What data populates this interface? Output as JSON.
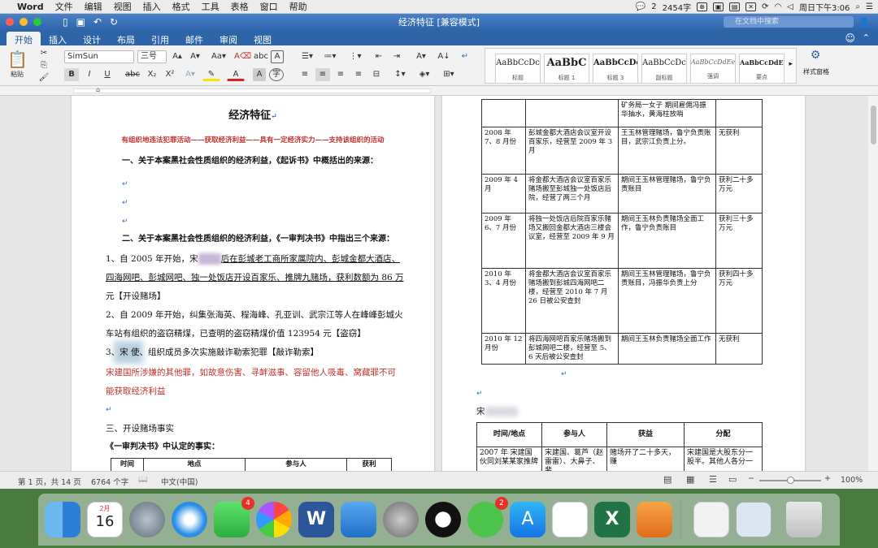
{
  "menubar": {
    "app": "Word",
    "items": [
      "文件",
      "编辑",
      "视图",
      "插入",
      "格式",
      "工具",
      "表格",
      "窗口",
      "帮助"
    ],
    "wechat_count": "2",
    "file_size": "2454字",
    "datetime": "周日下午3:06"
  },
  "window": {
    "title": "经济特征 [兼容模式]",
    "search_placeholder": "在文档中搜索"
  },
  "ribbon": {
    "tabs": [
      "开始",
      "插入",
      "设计",
      "布局",
      "引用",
      "邮件",
      "审阅",
      "视图"
    ],
    "active_tab": "开始",
    "paste_label": "粘贴",
    "font_name": "SimSun",
    "font_size": "三号",
    "styles": [
      {
        "sample": "AaBbCcDc",
        "name": "标题"
      },
      {
        "sample": "AaBbC",
        "name": "标题 1"
      },
      {
        "sample": "AaBbCcDc",
        "name": "标题 3"
      },
      {
        "sample": "AaBbCcDc",
        "name": "副标题"
      },
      {
        "sample": "AaBbCcDdEe",
        "name": "强调"
      },
      {
        "sample": "AaBbCcDdEe",
        "name": "要点"
      }
    ],
    "styles_pane": "样式窗格"
  },
  "doc_left": {
    "title": "经济特征",
    "subtitle": "有组织地违法犯罪活动——获取经济利益——具有一定经济实力——支持该组织的活动",
    "h1": "一、关于本案黑社会性质组织的经济利益，《起诉书》中概括出的来源：",
    "h2": "二、关于本案黑社会性质组织的经济利益，《一审判决书》中指出三个来源：",
    "p1a": "1、自 2005 年开始，宋",
    "p1b": "后在彭城老工商所家属院内、彭城金都大酒店、",
    "p1c": "四海网吧、彭城网吧、独一处饭店开设百家乐、推牌九赌场，获利数额为 86 万",
    "p1d": "元【开设赌场】",
    "p2a": "2、自 2009 年开始，纠集张海英、程海峰、孔亚训、武宗江等人在峰峰彭城火",
    "p2b": "车站有组织的盗窃精煤，已查明的盗窃精煤价值 123954 元【盗窃】",
    "p3": "3、宋       使、组织成员多次实施敲诈勒索犯罪【敲诈勒索】",
    "red1": "宋建国所涉嫌的其他罪，如故意伤害、寻衅滋事、容留他人吸毒、窝藏罪不可",
    "red2": "能获取经济利益",
    "h3": "三、开设赌场事实",
    "h4": "《一审判决书》中认定的事实：",
    "table_head": [
      "时间",
      "地点",
      "参与人",
      "获利"
    ]
  },
  "doc_right": {
    "table1": [
      [
        "",
        "",
        "矿务局一女子 期间雇佣冯振华抽水，黄海柱放哨",
        ""
      ],
      [
        "2008 年 7、8 月份",
        "彭城金都大酒店会议室开设百家乐，经营至 2009 年 3 月",
        "王玉林管理赌场，鲁宁负责账目，武宗江负责上分。",
        "无获利"
      ],
      [
        "2009 年 4 月",
        "将金都大酒店会议室百家乐赌场搬至彭城独一处饭店后院，经营了两三个月",
        "期间王玉林管理赌场，鲁宁负责账目",
        "获利二十多万元"
      ],
      [
        "2009 年 6、7 月份",
        "将独一处饭店后院百家乐赌场又搬回金都大酒店三楼会议室，经营至 2009 年 9 月",
        "期间王玉林负责赌场全面工作，鲁宁负责账目",
        "获利三十多万元"
      ],
      [
        "2010 年 3、4 月份",
        "将金都大酒店会议室百家乐赌场搬到彭城四海网吧二楼，经营至 2010 年 7 月 26 日被公安查封",
        "期间王玉林管理赌场，鲁宁负责账目，冯振华负责上分",
        "获利四十多万元"
      ],
      [
        "2010 年 12 月份",
        "将四海网吧百家乐赌场搬到彭城网吧二楼，经营至 5、6 天后被公安查封",
        "期间王玉林负责赌场全面工作",
        "无获利"
      ]
    ],
    "label": "宋",
    "table2_head": [
      "时间/地点",
      "参与人",
      "获益",
      "分配"
    ],
    "table2_row": [
      "2007 年 宋建国伙同刘某某家推牌",
      "宋建国、葛芦（赵雷雷）、大鼻子、裴",
      "赌场开了二十多天，赚",
      "宋建国是大股东分一股半。其他人各分一"
    ]
  },
  "status": {
    "page": "第 1 页，共 14 页",
    "words": "6764 个字",
    "lang": "中文(中国)",
    "zoom": "100%",
    "zoom_level": 0.5
  },
  "dock": {
    "calendar_month": "2月",
    "calendar_day": "16",
    "facetime_badge": "4",
    "wechat_badge": "2",
    "icons": [
      "finder-icon",
      "calendar-icon",
      "launchpad-icon",
      "safari-icon",
      "facetime-icon",
      "photos-icon",
      "word-icon",
      "keynote-icon",
      "system-preferences-icon",
      "qq-icon",
      "wechat-icon",
      "app-store-icon",
      "numbers-icon",
      "excel-icon",
      "pages-icon",
      "document-icon",
      "preview-icon",
      "trash-icon"
    ]
  },
  "colors": {
    "titlebar": "#2e64a8",
    "accent_red": "#c0302b",
    "paragraph_mark": "#3a6fcb"
  }
}
